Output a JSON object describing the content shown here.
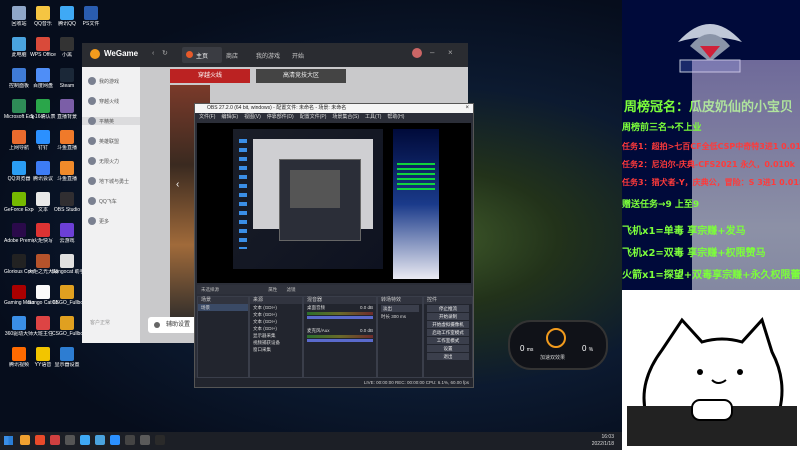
{
  "desktop_icons": [
    {
      "label": "回收站",
      "color": "#8fa7c9"
    },
    {
      "label": "QQ音乐",
      "color": "#f5c542"
    },
    {
      "label": "腾讯QQ",
      "color": "#3fa9f5"
    },
    {
      "label": "PS文件",
      "color": "#2a5db0"
    },
    {
      "label": "此电脑",
      "color": "#4aa3df"
    },
    {
      "label": "WPS Office",
      "color": "#d94a3a"
    },
    {
      "label": "小黑",
      "color": "#333333"
    },
    {
      "label": "控制面板",
      "color": "#3f7bd6"
    },
    {
      "label": "百度网盘",
      "color": "#4f8ef7"
    },
    {
      "label": "Steam",
      "color": "#1b2838"
    },
    {
      "label": "Microsoft Edge",
      "color": "#2e8b57"
    },
    {
      "label": "5-16确认表",
      "color": "#2aa64a"
    },
    {
      "label": "直播背景",
      "color": "#7b5ea7"
    },
    {
      "label": "上网导航",
      "color": "#e96a2d"
    },
    {
      "label": "钉钉",
      "color": "#2b90ff"
    },
    {
      "label": "斗鱼直播",
      "color": "#f07a2a"
    },
    {
      "label": "QQ浏览器",
      "color": "#2a9df4"
    },
    {
      "label": "腾讯会议",
      "color": "#3d7cf5"
    },
    {
      "label": "斗鱼直播",
      "color": "#f08a2a"
    },
    {
      "label": "GeForce Experience",
      "color": "#76b900"
    },
    {
      "label": "文本",
      "color": "#e8e8e8"
    },
    {
      "label": "OBS Studio",
      "color": "#302e31"
    },
    {
      "label": "Adobe Premie...",
      "color": "#2a0a4a"
    },
    {
      "label": "火炬快写",
      "color": "#d33"
    },
    {
      "label": "云游戏",
      "color": "#6c3fd6"
    },
    {
      "label": "Glorious Core",
      "color": "#222222"
    },
    {
      "label": "火炬之光大战",
      "color": "#b5532b"
    },
    {
      "label": "Bongocat 助手",
      "color": "#e0e0e0"
    },
    {
      "label": "Gaming Mouse",
      "color": "#a00"
    },
    {
      "label": "Bongo Cat Mver",
      "color": "#fafafa"
    },
    {
      "label": "CSGO_Fullbo...",
      "color": "#e0a020"
    },
    {
      "label": "360驱动大师",
      "color": "#3a8ee6"
    },
    {
      "label": "大班主任",
      "color": "#d44"
    },
    {
      "label": "CSGO_Fullbo...",
      "color": "#e0a020"
    },
    {
      "label": "腾讯视频",
      "color": "#ff6a00"
    },
    {
      "label": "YY语音",
      "color": "#f2c500"
    },
    {
      "label": "显示器设置",
      "color": "#2d7dd2"
    }
  ],
  "taskbar": {
    "apps": [
      "#f0a030",
      "#e84a2a",
      "#d04040",
      "#555555",
      "#3fa9f5",
      "#4aa3df",
      "#2b90ff",
      "#444444",
      "#5a5a5a",
      "#2a2a2a"
    ],
    "time": "16:03",
    "date": "2022/1/18"
  },
  "wegame": {
    "logo": "WeGame",
    "tabs": [
      "主页",
      "商店",
      "我的游戏"
    ],
    "subtabs": [
      "穿越火线",
      "高清竞技大区"
    ],
    "sidebar": [
      "我的游戏",
      "穿越火线",
      "平精英",
      "英雄联盟",
      "无限火力",
      "地下城与勇士",
      "QQ飞车",
      "更多"
    ],
    "bottom_left": "客户正常",
    "settings_btn": "辅助设置",
    "tab_start": "开始"
  },
  "obs": {
    "title": "OBS 27.2.0 (64 bit, windows) - 配置文件: 未命名 - 场景: 未命名",
    "menu": [
      "文件(F)",
      "编辑(E)",
      "视图(V)",
      "停靠部件(D)",
      "配置文件(P)",
      "场景集合(S)",
      "工具(T)",
      "帮助(H)"
    ],
    "info_bar": "未选择源",
    "properties": "属性",
    "filters": "滤镜",
    "docks": {
      "scenes": {
        "title": "场景",
        "items": [
          "场景"
        ]
      },
      "sources": {
        "title": "来源",
        "items": [
          "文本 (GDI+)",
          "文本 (GDI+)",
          "文本 (GDI+)",
          "文本 (GDI+)",
          "显示器采集",
          "视频捕获设备",
          "窗口采集"
        ]
      },
      "mixer": {
        "title": "混音器",
        "items": [
          "桌面音频",
          "麦克风/Aux"
        ],
        "levels": [
          "0.0 dB",
          "0.0 dB"
        ]
      },
      "transitions": {
        "title": "转场特效",
        "type": "淡出",
        "duration_label": "时长",
        "duration": "300 ms"
      },
      "controls": {
        "title": "控件",
        "buttons": [
          "停止推流",
          "开始录制",
          "开始虚拟摄像机",
          "启动工作室模式",
          "工作室模式",
          "设置",
          "退出"
        ]
      }
    },
    "status": "LIVE: 00:00:00   REC: 00:00:00   CPU: 6.1%, 60.00 fps"
  },
  "net_widget": {
    "label": "加速双效果",
    "left_value": "0",
    "left_unit": "ms",
    "right_value": "0",
    "right_unit": "%"
  },
  "overlay": {
    "title_lines": [
      "周榜冠名：瓜皮奶仙的小宝贝"
    ],
    "green_lines": [
      "周榜前三名→不上业",
      "赠送任务→9 上至9",
      "飞机x1=单毒 享宗赚+发马",
      "飞机x2=双毒 享宗赚+权限赞马",
      "火箭x1=探望+双毒享宗赚+永久权限蕾马"
    ],
    "red_lines": [
      "任务1：超拍>七百CF全低CSP中奇特3进1 0.010k",
      "任务2：尼泊尔-庆典-CFS2021 永久，0.010k",
      "任务3：猎犬者-Y，庆典公，冒险：S 3进1 0.015k"
    ]
  }
}
